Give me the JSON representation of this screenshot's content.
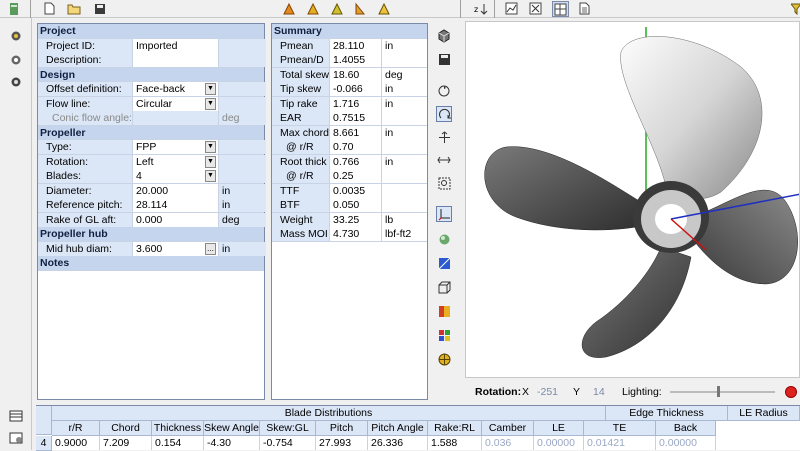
{
  "colors": {
    "section_bg": "#c5d5ee",
    "label_bg": "#dbe6f6",
    "panel_border": "#7a8aa8",
    "axis_green": "#22aa22",
    "axis_blue": "#2030c0",
    "axis_red": "#cc1010",
    "record_red": "#dd2222"
  },
  "toolbar": {
    "icons": [
      "app-icon",
      "new-file-icon",
      "open-folder-icon",
      "save-icon",
      "blade-tool-icon",
      "blade-tool-icon",
      "blade-tool-icon",
      "blade-tool-icon",
      "blade-tool-icon",
      "sort-icon",
      "chart-icon",
      "chart-icon",
      "grid-icon",
      "page-icon",
      "filter-icon"
    ]
  },
  "properties": {
    "project": {
      "title": "Project",
      "project_id_label": "Project ID:",
      "project_id_value": "Imported",
      "description_label": "Description:",
      "description_value": ""
    },
    "design": {
      "title": "Design",
      "offset_label": "Offset definition:",
      "offset_value": "Face-back",
      "flow_label": "Flow line:",
      "flow_value": "Circular",
      "conic_label": "Conic flow angle:",
      "conic_value": "",
      "conic_unit": "deg"
    },
    "propeller": {
      "title": "Propeller",
      "type_label": "Type:",
      "type_value": "FPP",
      "rotation_label": "Rotation:",
      "rotation_value": "Left",
      "blades_label": "Blades:",
      "blades_value": "4",
      "diameter_label": "Diameter:",
      "diameter_value": "20.000",
      "diameter_unit": "in",
      "pitch_label": "Reference pitch:",
      "pitch_value": "28.114",
      "pitch_unit": "in",
      "rake_label": "Rake of GL aft:",
      "rake_value": "0.000",
      "rake_unit": "deg"
    },
    "hub": {
      "title": "Propeller hub",
      "mid_label": "Mid hub diam:",
      "mid_value": "3.600",
      "mid_button": "...",
      "mid_unit": "in"
    },
    "notes": {
      "title": "Notes"
    }
  },
  "summary": {
    "title": "Summary",
    "rows": [
      {
        "label": "Pmean",
        "value": "28.110",
        "unit": "in"
      },
      {
        "label": "Pmean/D",
        "value": "1.4055",
        "unit": ""
      },
      {
        "label": "Total skew",
        "value": "18.60",
        "unit": "deg"
      },
      {
        "label": "Tip skew",
        "value": "-0.066",
        "unit": "in"
      },
      {
        "label": "Tip rake",
        "value": "1.716",
        "unit": "in"
      },
      {
        "label": "EAR",
        "value": "0.7515",
        "unit": ""
      },
      {
        "label": "Max chord",
        "value": "8.661",
        "unit": "in"
      },
      {
        "label": "@ r/R",
        "value": "0.70",
        "unit": ""
      },
      {
        "label": "Root thick",
        "value": "0.766",
        "unit": "in"
      },
      {
        "label": "@ r/R",
        "value": "0.25",
        "unit": ""
      },
      {
        "label": "TTF",
        "value": "0.0035",
        "unit": ""
      },
      {
        "label": "BTF",
        "value": "0.050",
        "unit": ""
      },
      {
        "label": "Weight",
        "value": "33.25",
        "unit": "lb"
      },
      {
        "label": "Mass MOI",
        "value": "4.730",
        "unit": "lbf-ft2"
      }
    ]
  },
  "vertical_tools": [
    "cube-icon",
    "save-view-icon",
    "rotate-icon",
    "spin-icon",
    "move-icon",
    "pan-icon",
    "zoom-icon",
    "axes-icon",
    "surface-icon",
    "view-box-icon",
    "box-icon",
    "color-map-icon",
    "palette-icon",
    "sphere-icon"
  ],
  "rotation": {
    "label": "Rotation:",
    "x_label": "X",
    "x_value": "-251",
    "y_label": "Y",
    "y_value": "14",
    "lighting_label": "Lighting:",
    "lighting_level": 0.45
  },
  "blade_table": {
    "group_blade": "Blade Distributions",
    "group_edge": "Edge Thickness",
    "group_le_radius": "LE Radius",
    "columns": [
      "r/R",
      "Chord",
      "Thickness",
      "Skew Angle",
      "Skew:GL",
      "Pitch",
      "Pitch Angle",
      "Rake:RL",
      "Camber",
      "LE",
      "TE",
      "Back"
    ],
    "row_index": "4",
    "row": [
      "0.9000",
      "7.209",
      "0.154",
      "-4.30",
      "-0.754",
      "27.993",
      "26.336",
      "1.588",
      "0.036",
      "0.00000",
      "0.01421",
      "0.00000"
    ]
  }
}
